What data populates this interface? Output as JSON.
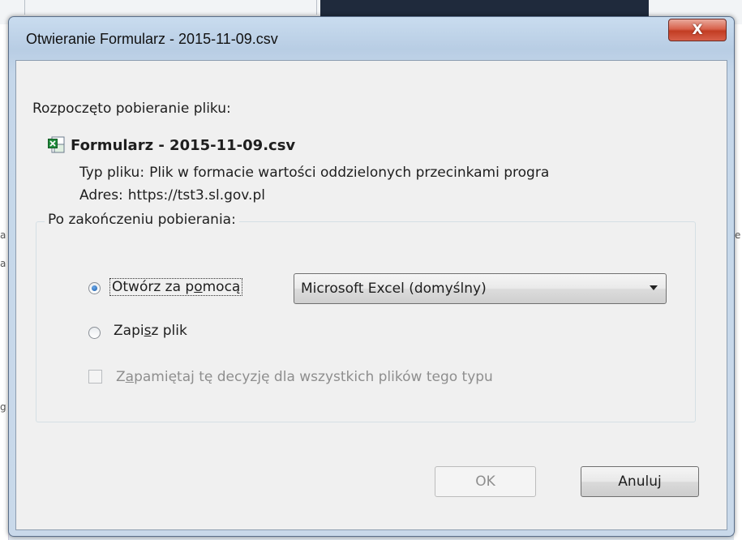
{
  "window": {
    "title": "Otwieranie Formularz - 2015-11-09.csv",
    "close_label": "X"
  },
  "dialog": {
    "heading": "Rozpoczęto pobieranie pliku:",
    "file_name": "Formularz - 2015-11-09.csv",
    "file_icon": "excel-csv-icon",
    "file_type_label": "Typ pliku:",
    "file_type_value": "Plik w formacie wartości oddzielonych przecinkami progra",
    "address_label": "Adres:",
    "address_value": "https://tst3.sl.gov.pl"
  },
  "after_download": {
    "legend": "Po zakończeniu pobierania:",
    "open_with": {
      "label_pre": "Otwórz za p",
      "label_mnemonic": "o",
      "label_post": "mocą",
      "selected": true
    },
    "app_select": {
      "value": "Microsoft Excel (domyślny)"
    },
    "save_file": {
      "label_pre": "Zapi",
      "label_mnemonic": "s",
      "label_post": "z plik",
      "selected": false
    },
    "remember": {
      "label_pre": "Z",
      "label_mnemonic": "a",
      "label_post": "pamiętaj tę decyzję dla wszystkich plików tego typu",
      "checked": false,
      "disabled": true
    }
  },
  "buttons": {
    "ok": "OK",
    "cancel": "Anuluj"
  },
  "background": {
    "left_chars": [
      "a",
      "a",
      "g"
    ],
    "right_chars": [
      "e"
    ]
  },
  "colors": {
    "frame": "#c9dcef",
    "close": "#c23d23",
    "client": "#f0f0f0",
    "radio_dot": "#1c5ba8"
  }
}
